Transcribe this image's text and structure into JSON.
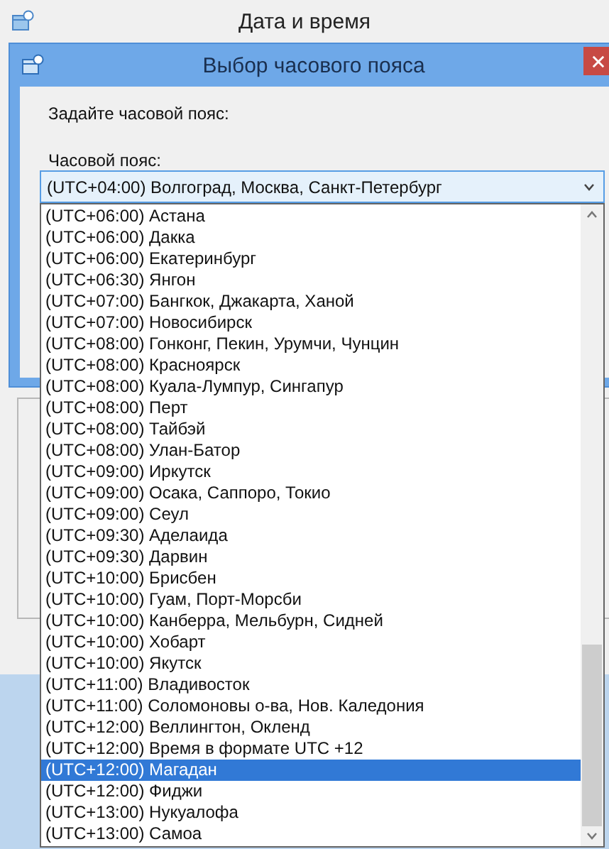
{
  "window": {
    "title": "Дата и время"
  },
  "dialog": {
    "title": "Выбор часового пояса",
    "prompt": "Задайте часовой пояс:",
    "field_label": "Часовой пояс:",
    "value": "(UTC+04:00) Волгоград, Москва, Санкт-Петербург"
  },
  "timezones": [
    {
      "label": "(UTC+06:00) Астана",
      "selected": false
    },
    {
      "label": "(UTC+06:00) Дакка",
      "selected": false
    },
    {
      "label": "(UTC+06:00) Екатеринбург",
      "selected": false
    },
    {
      "label": "(UTC+06:30) Янгон",
      "selected": false
    },
    {
      "label": "(UTC+07:00) Бангкок, Джакарта, Ханой",
      "selected": false
    },
    {
      "label": "(UTC+07:00) Новосибирск",
      "selected": false
    },
    {
      "label": "(UTC+08:00) Гонконг, Пекин, Урумчи, Чунцин",
      "selected": false
    },
    {
      "label": "(UTC+08:00) Красноярск",
      "selected": false
    },
    {
      "label": "(UTC+08:00) Куала-Лумпур, Сингапур",
      "selected": false
    },
    {
      "label": "(UTC+08:00) Перт",
      "selected": false
    },
    {
      "label": "(UTC+08:00) Тайбэй",
      "selected": false
    },
    {
      "label": "(UTC+08:00) Улан-Батор",
      "selected": false
    },
    {
      "label": "(UTC+09:00) Иркутск",
      "selected": false
    },
    {
      "label": "(UTC+09:00) Осака, Саппоро, Токио",
      "selected": false
    },
    {
      "label": "(UTC+09:00) Сеул",
      "selected": false
    },
    {
      "label": "(UTC+09:30) Аделаида",
      "selected": false
    },
    {
      "label": "(UTC+09:30) Дарвин",
      "selected": false
    },
    {
      "label": "(UTC+10:00) Брисбен",
      "selected": false
    },
    {
      "label": "(UTC+10:00) Гуам, Порт-Морсби",
      "selected": false
    },
    {
      "label": "(UTC+10:00) Канберра, Мельбурн, Сидней",
      "selected": false
    },
    {
      "label": "(UTC+10:00) Хобарт",
      "selected": false
    },
    {
      "label": "(UTC+10:00) Якутск",
      "selected": false
    },
    {
      "label": "(UTC+11:00) Владивосток",
      "selected": false
    },
    {
      "label": "(UTC+11:00) Соломоновы о-ва, Нов. Каледония",
      "selected": false
    },
    {
      "label": "(UTC+12:00) Веллингтон, Окленд",
      "selected": false
    },
    {
      "label": "(UTC+12:00) Время в формате UTC +12",
      "selected": false
    },
    {
      "label": "(UTC+12:00) Магадан",
      "selected": true
    },
    {
      "label": "(UTC+12:00) Фиджи",
      "selected": false
    },
    {
      "label": "(UTC+13:00) Нукуалофа",
      "selected": false
    },
    {
      "label": "(UTC+13:00) Самоа",
      "selected": false
    }
  ]
}
